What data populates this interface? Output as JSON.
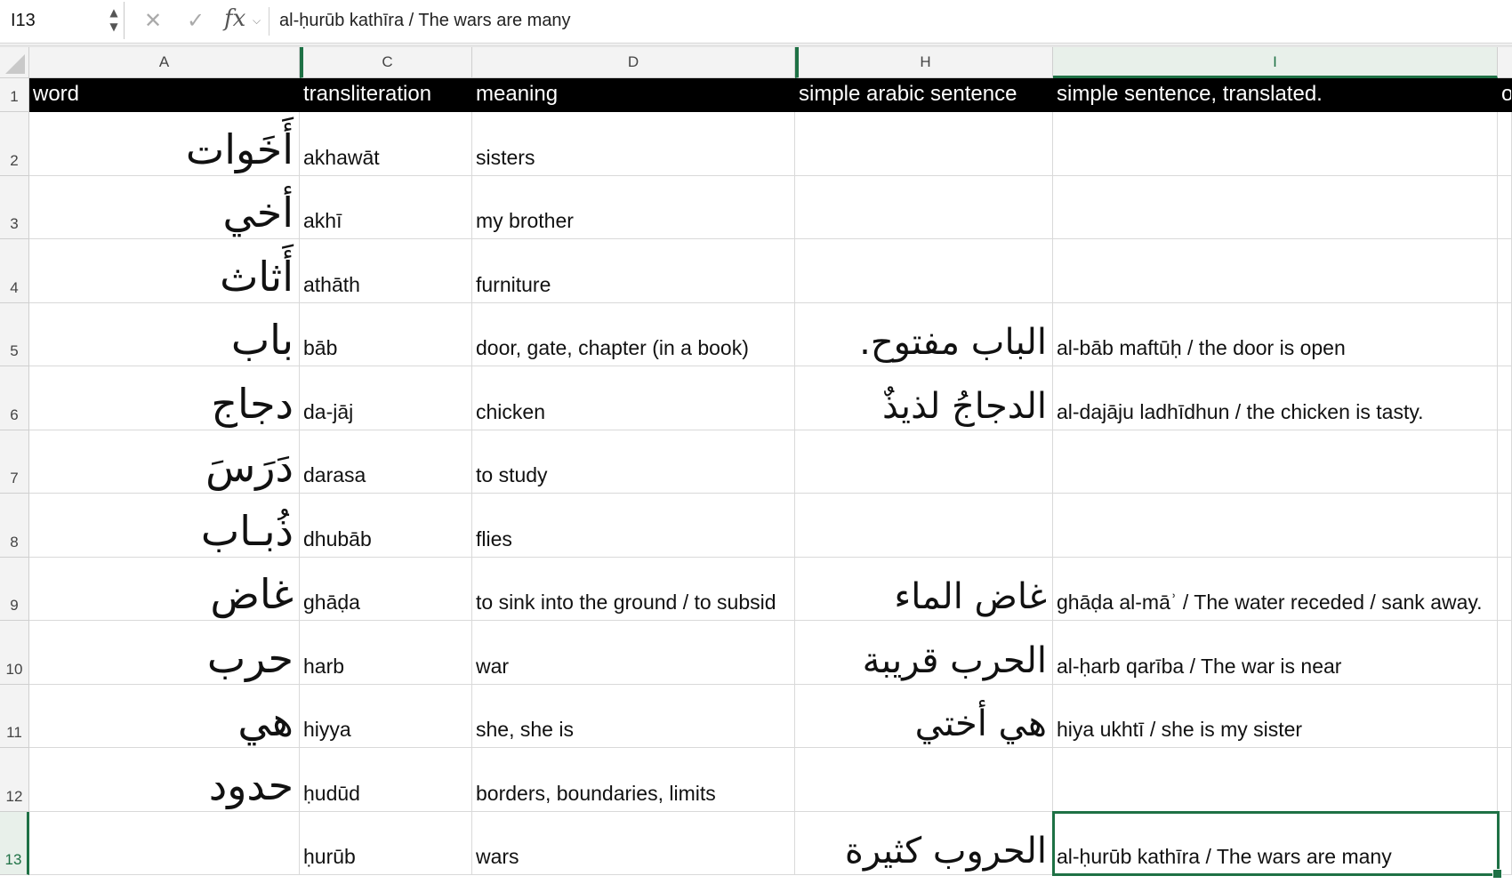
{
  "formula_bar": {
    "name_box": "I13",
    "cancel_icon": "✕",
    "enter_icon": "✓",
    "fx_label": "fx",
    "content": "al-ḥurūb kathīra / The wars are many"
  },
  "columns": [
    "A",
    "C",
    "D",
    "H",
    "I"
  ],
  "header_row": {
    "word": "word",
    "transliteration": "transliteration",
    "meaning": "meaning",
    "arabic_sentence": "simple arabic sentence",
    "translated": "simple sentence, translated.",
    "next_partial": "ot"
  },
  "rows": [
    {
      "num": "1"
    },
    {
      "num": "2",
      "word": "أَخَوات",
      "translit": "akhawāt",
      "meaning": "sisters",
      "sentence": "",
      "translated": ""
    },
    {
      "num": "3",
      "word": "أخي",
      "translit": "akhī",
      "meaning": "my brother",
      "sentence": "",
      "translated": ""
    },
    {
      "num": "4",
      "word": "أَثاث",
      "translit": "athāth",
      "meaning": "furniture",
      "sentence": "",
      "translated": ""
    },
    {
      "num": "5",
      "word": "باب",
      "translit": "bāb",
      "meaning": "door, gate, chapter (in a book)",
      "sentence": "الباب مفتوح.",
      "translated": "al-bāb maftūḥ / the door is open"
    },
    {
      "num": "6",
      "word": "دجاج",
      "translit": "da-jāj",
      "meaning": "chicken",
      "sentence": "الدجاجُ لذيذٌ",
      "translated": "al-dajāju ladhīdhun / the chicken is tasty."
    },
    {
      "num": "7",
      "word": "دَرَسَ",
      "translit": "darasa",
      "meaning": "to study",
      "sentence": "",
      "translated": ""
    },
    {
      "num": "8",
      "word": "ذُبـاب",
      "translit": "dhubāb",
      "meaning": "flies",
      "sentence": "",
      "translated": ""
    },
    {
      "num": "9",
      "word": "غاض",
      "translit": "ghāḍa",
      "meaning": "to sink into the ground / to subsid",
      "sentence": "غاض الماء",
      "translated": "ghāḍa al-māʾ / The water receded / sank away."
    },
    {
      "num": "10",
      "word": "حرب",
      "translit": "harb",
      "meaning": "war",
      "sentence": "الحرب قريبة",
      "translated": "al-ḥarb qarība / The war is near"
    },
    {
      "num": "11",
      "word": "هي",
      "translit": "hiyya",
      "meaning": "she, she is",
      "sentence": "هي أختي",
      "translated": "hiya ukhtī / she is my sister"
    },
    {
      "num": "12",
      "word": "حدود",
      "translit": "ḥudūd",
      "meaning": "borders, boundaries, limits",
      "sentence": "",
      "translated": ""
    },
    {
      "num": "13",
      "word": "",
      "translit": "ḥurūb",
      "meaning": "wars",
      "sentence": "الحروب كثيرة",
      "translated": "al-ḥurūb kathīra / The wars are many"
    }
  ],
  "colors": {
    "accent": "#1e7145",
    "header_bg": "#000000",
    "header_text": "#ffffff"
  }
}
